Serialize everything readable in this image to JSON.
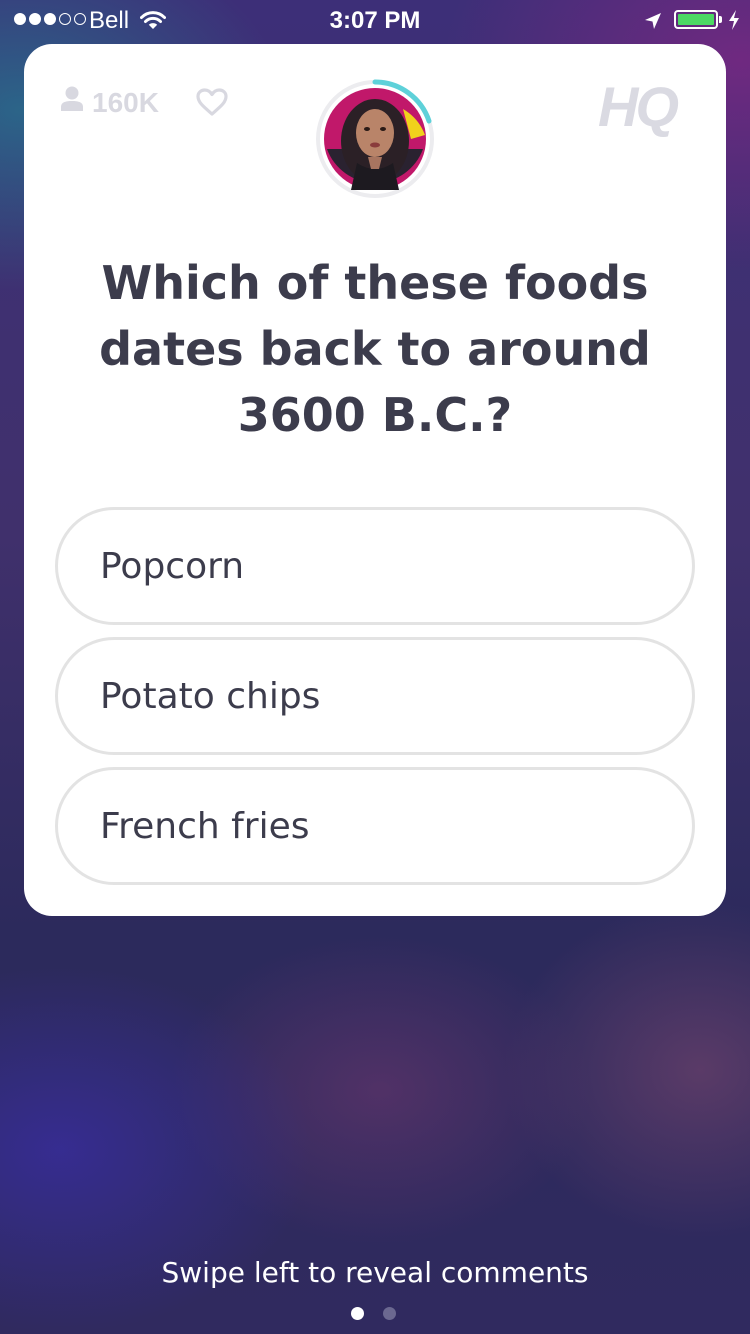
{
  "status_bar": {
    "carrier": "Bell",
    "time": "3:07 PM",
    "signal_bars_filled": 3,
    "signal_bars_total": 5,
    "battery_level": 1.0,
    "battery_color": "#4cd964",
    "icons": [
      "wifi-icon",
      "location-arrow-icon",
      "battery-icon",
      "charging-bolt-icon"
    ]
  },
  "card": {
    "viewer_count": "160K",
    "viewer_icon": "person-icon",
    "like_icon": "heart-outline-icon",
    "logo": "HQ",
    "host_avatar": "host-avatar",
    "timer_ring_color": "#5ed1d9",
    "question": "Which of these foods dates back to around 3600 B.C.?",
    "answers": [
      "Popcorn",
      "Potato chips",
      "French fries"
    ]
  },
  "footer": {
    "hint": "Swipe left to reveal comments",
    "page_indicator": {
      "current": 1,
      "total": 2,
      "active_color": "#ffffff",
      "inactive_color": "#6b6890"
    }
  }
}
